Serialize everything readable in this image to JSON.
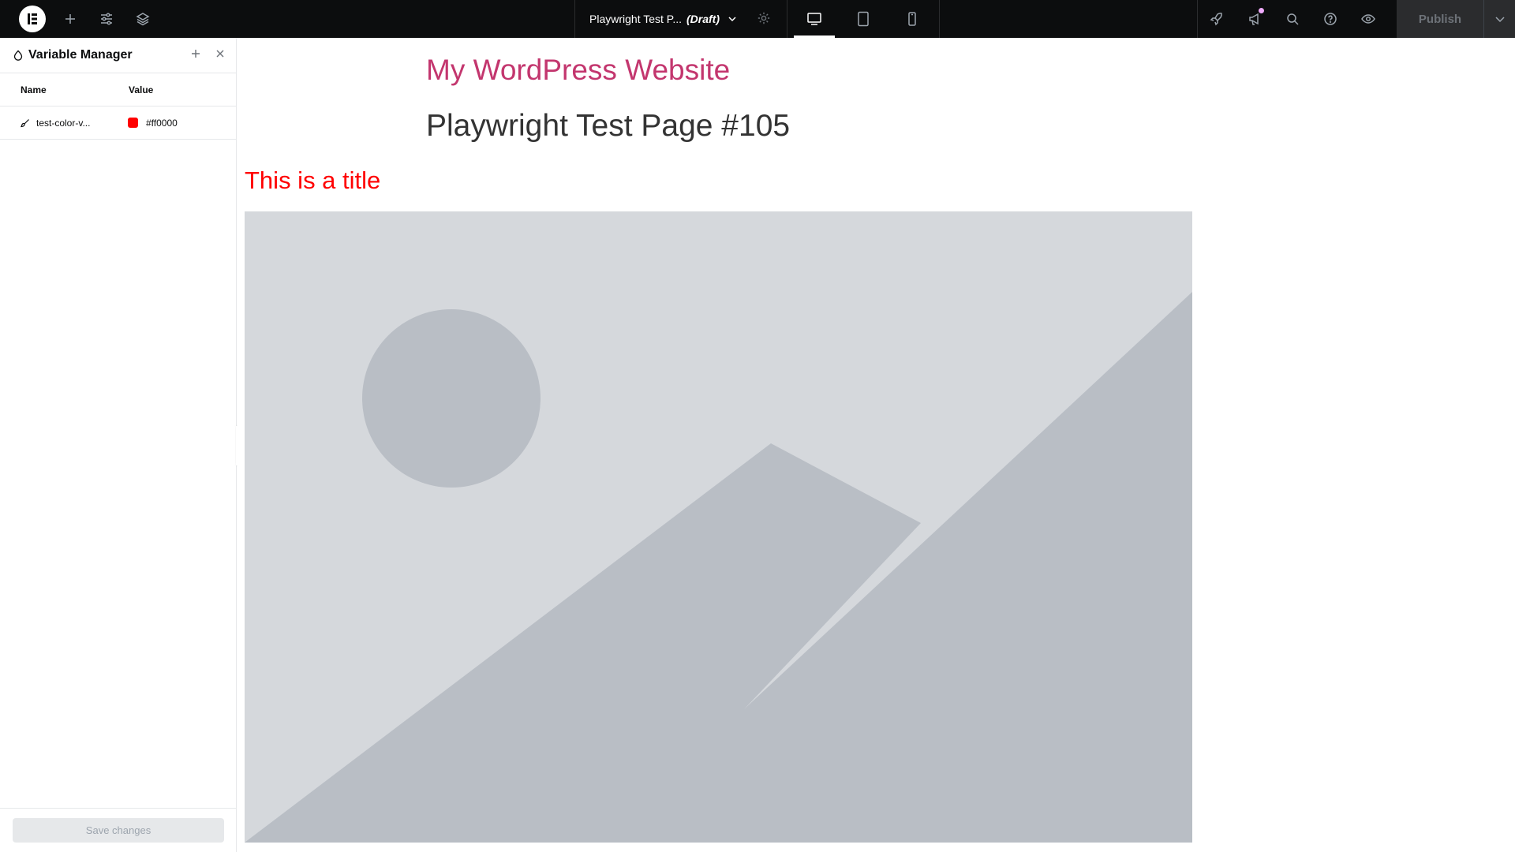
{
  "topbar": {
    "document_name": "Playwright Test P...",
    "document_status": "(Draft)",
    "publish_label": "Publish"
  },
  "panel": {
    "title": "Variable Manager",
    "columns": {
      "name": "Name",
      "value": "Value"
    },
    "variables": [
      {
        "name": "test-color-v...",
        "value": "#ff0000",
        "swatch_color": "#ff0000"
      }
    ],
    "save_label": "Save changes"
  },
  "canvas": {
    "site_title": "My WordPress Website",
    "page_title": "Playwright Test Page #105",
    "widget_title": "This is a title",
    "widget_title_color": "#ff0000"
  },
  "colors": {
    "accent_site_title": "#c3366e",
    "topbar_bg": "#0c0d0e",
    "placeholder_bg": "#d5d8dc",
    "placeholder_shape": "#b9bec5"
  }
}
